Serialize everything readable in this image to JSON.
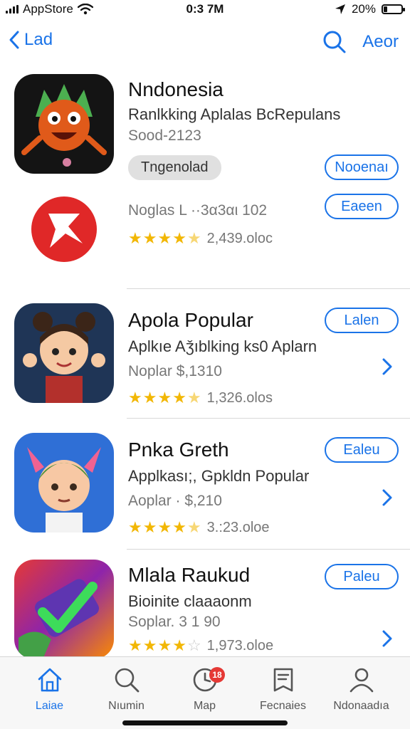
{
  "status_bar": {
    "carrier": "AppStore",
    "time": "0:3 7M",
    "battery": "20%",
    "battery_level": 0.2
  },
  "nav": {
    "back_label": "Lad",
    "right_action": "Aeor"
  },
  "items": [
    {
      "title": "Nndonesia",
      "subtitle": "Ranlkking Aplalas BcRepulans",
      "meta": "Sood-2123",
      "tag": "Tngenolad",
      "button": "Nooenaı"
    },
    {
      "meta": "Noglas  L ··3α3αι 102",
      "rating_value": 4.5,
      "rating_count": "2,439.oloc",
      "button": "Eaeen"
    },
    {
      "title": "Apola Popular",
      "subtitle": "Aplkıe Aǯıblking ks0 Aplarn",
      "meta": "Noplar   $,1310",
      "rating_value": 4.5,
      "rating_count": "1,326.olos",
      "button": "Lalen"
    },
    {
      "title": "Pnka Greth",
      "subtitle": "Applkası;, Gpkldn Popular",
      "meta": "Aoplar  · $,210",
      "rating_value": 4.5,
      "rating_count": "3.:23.oloe",
      "button": "Ealeu"
    },
    {
      "title": "Mlala Raukud",
      "subtitle": "Bioinite claaaonm",
      "meta": "Soplar.   3 1 90",
      "rating_value": 4,
      "rating_count": "1,973.oloe",
      "button": "Paleu"
    }
  ],
  "tabs": [
    {
      "label": "Laiae",
      "icon": "home-icon",
      "active": true
    },
    {
      "label": "Nıumin",
      "icon": "search-icon",
      "active": false
    },
    {
      "label": "Map",
      "icon": "clock-icon",
      "active": false,
      "badge": "18"
    },
    {
      "label": "Fecnaies",
      "icon": "document-icon",
      "active": false
    },
    {
      "label": "Ndonaadıa",
      "icon": "person-icon",
      "active": false
    }
  ],
  "colors": {
    "accent": "#1a73e8",
    "star": "#f2b705",
    "badge": "#e53935",
    "divider": "#d8d8d8"
  }
}
